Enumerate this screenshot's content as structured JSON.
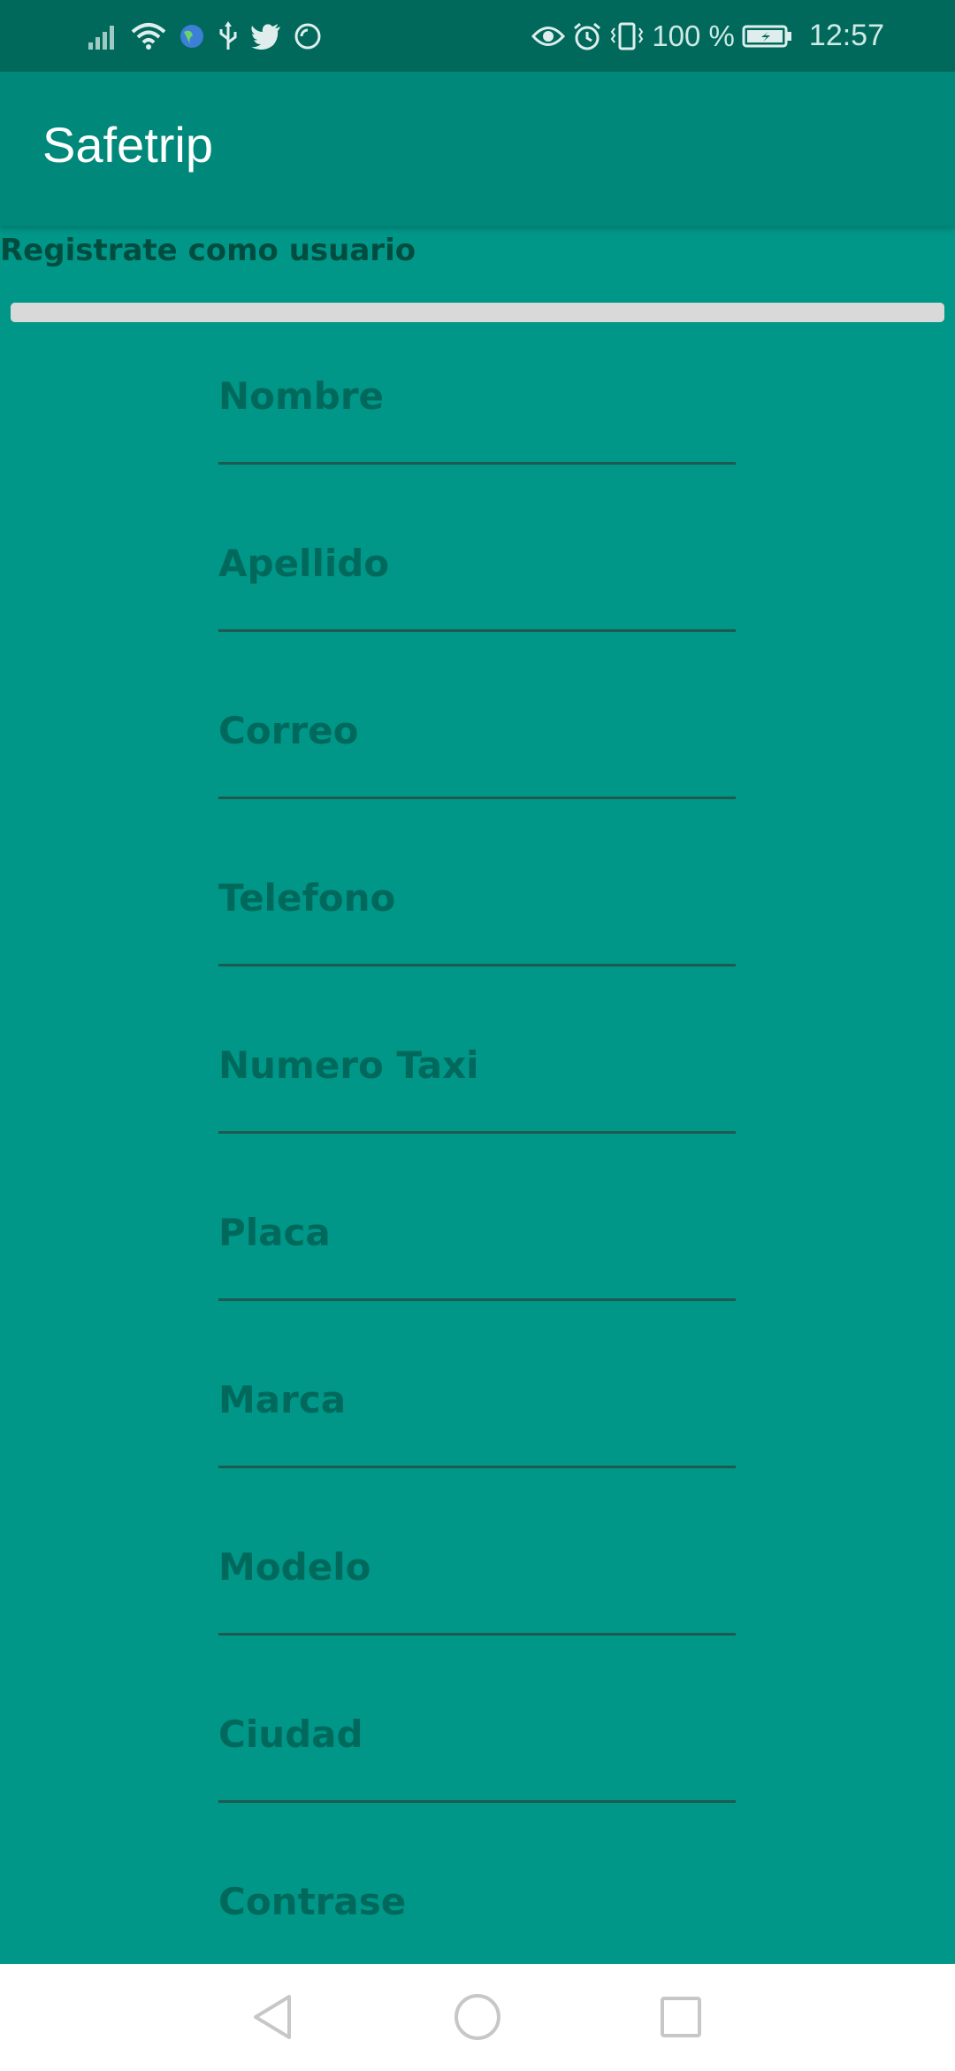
{
  "status_bar": {
    "battery_level": "100 %",
    "clock": "12:57",
    "icons": [
      "signal-icon",
      "wifi-icon",
      "vpn-globe-icon",
      "usb-icon",
      "twitter-icon",
      "sync-icon",
      "eye-icon",
      "alarm-icon",
      "vibrate-icon",
      "battery-icon"
    ]
  },
  "app_bar": {
    "title": "Safetrip"
  },
  "form": {
    "heading": "Registrate como usuario",
    "progress": 1.0,
    "fields": [
      {
        "name": "nombre-field",
        "label": "Nombre"
      },
      {
        "name": "apellido-field",
        "label": "Apellido"
      },
      {
        "name": "correo-field",
        "label": "Correo"
      },
      {
        "name": "telefono-field",
        "label": "Telefono"
      },
      {
        "name": "numero-taxi-field",
        "label": "Numero Taxi"
      },
      {
        "name": "placa-field",
        "label": "Placa"
      },
      {
        "name": "marca-field",
        "label": "Marca"
      },
      {
        "name": "modelo-field",
        "label": "Modelo"
      },
      {
        "name": "ciudad-field",
        "label": "Ciudad"
      },
      {
        "name": "contrasena-field",
        "label": "Contrase"
      }
    ]
  },
  "colors": {
    "status_bar": "#00695C",
    "app_bar": "#00897B",
    "background": "#009688",
    "label_text": "#00695C",
    "heading_text": "#004D40"
  },
  "nav_bar": {
    "icons": [
      "back-icon",
      "home-icon",
      "recents-icon"
    ]
  }
}
